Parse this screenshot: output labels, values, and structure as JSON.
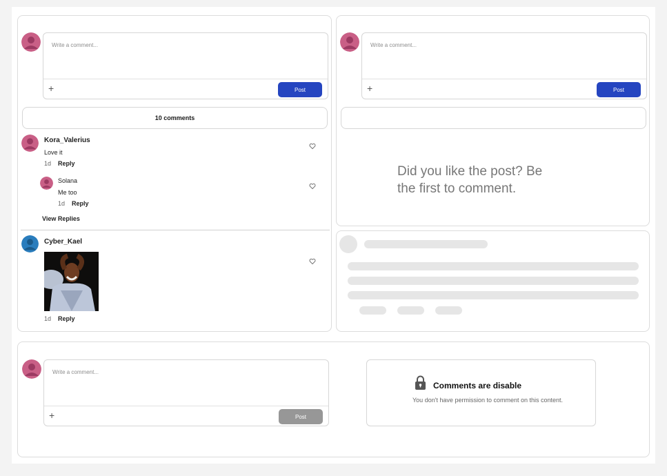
{
  "colors": {
    "accent": "#2545c0",
    "disabled": "#979797",
    "avatar_pink": "#c95f86",
    "avatar_blue": "#2a7dbd"
  },
  "panel_a": {
    "composer": {
      "placeholder": "Write a comment...",
      "post_label": "Post",
      "add_icon": "plus-icon"
    },
    "comment_count": "10 comments",
    "comments": [
      {
        "user": "Kora_Valerius",
        "text": "Love it",
        "time": "1d",
        "reply": "Reply"
      },
      {
        "user": "Solana",
        "text": "Me too",
        "time": "1d",
        "reply": "Reply"
      }
    ],
    "view_replies": "View Replies",
    "comment2": {
      "user": "Cyber_Kael",
      "time": "1d",
      "reply": "Reply"
    }
  },
  "panel_b": {
    "composer": {
      "placeholder": "Write a comment...",
      "post_label": "Post"
    },
    "empty_message_line1": "Did you like the post? Be",
    "empty_message_line2": "the first to comment."
  },
  "panel_d": {
    "composer": {
      "placeholder": "Write a comment...",
      "post_label": "Post"
    },
    "disabled_card": {
      "title": "Comments are disable",
      "description": "You don't have permission to comment on this content.",
      "icon": "lock-icon"
    }
  }
}
